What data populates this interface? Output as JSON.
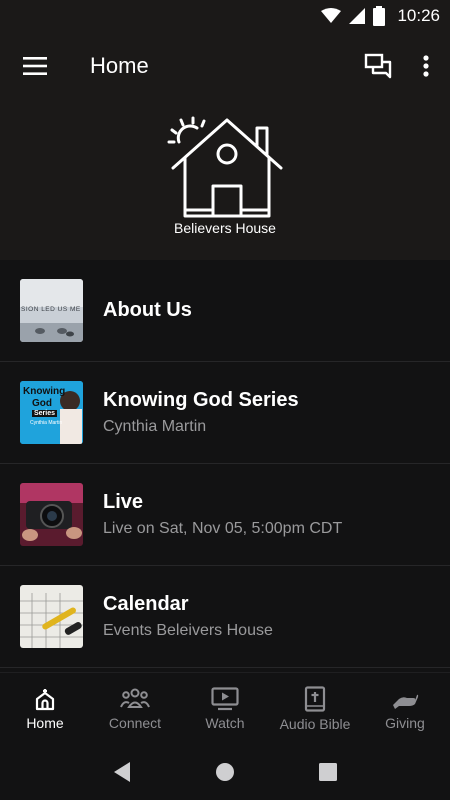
{
  "status": {
    "time": "10:26"
  },
  "app_bar": {
    "title": "Home"
  },
  "banner": {
    "logo_text": "Believers House"
  },
  "items": [
    {
      "title": "About Us",
      "subtitle": "",
      "thumb_text": "SION LED US ME"
    },
    {
      "title": "Knowing God Series",
      "subtitle": "Cynthia Martin",
      "thumb_text_1": "Knowing",
      "thumb_text_2": "God",
      "thumb_text_3": "Series",
      "thumb_text_4": "Cynthia Martin"
    },
    {
      "title": "Live",
      "subtitle": "Live on Sat, Nov 05, 5:00pm CDT"
    },
    {
      "title": "Calendar",
      "subtitle": "Events Beleivers House"
    }
  ],
  "nav": [
    {
      "label": "Home",
      "icon": "church-icon",
      "active": true
    },
    {
      "label": "Connect",
      "icon": "group-icon",
      "active": false
    },
    {
      "label": "Watch",
      "icon": "video-icon",
      "active": false
    },
    {
      "label": "Audio Bible",
      "icon": "bible-icon",
      "active": false
    },
    {
      "label": "Giving",
      "icon": "giving-icon",
      "active": false
    }
  ],
  "colors": {
    "background": "#121213",
    "header": "#1b1918",
    "muted": "#9a9a9c"
  }
}
